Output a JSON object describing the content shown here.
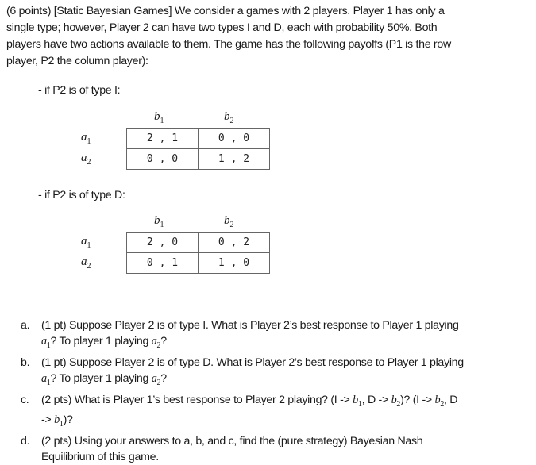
{
  "intro": {
    "lines": [
      "(6 points) [Static Bayesian Games] We consider a games with 2 players. Player 1 has only a",
      "single type; however, Player 2 can have two types I and D, each with probability 50%. Both",
      "players have two actions available to them. The game has the following payoffs (P1 is the row",
      "player, P2 the column player):"
    ]
  },
  "games": [
    {
      "heading": "- if P2 is of type I:",
      "cols": [
        "b",
        "b"
      ],
      "col_subs": [
        "1",
        "2"
      ],
      "rows": [
        "a",
        "a"
      ],
      "row_subs": [
        "1",
        "2"
      ],
      "cells": [
        [
          "2 , 1",
          "0 , 0"
        ],
        [
          "0 , 0",
          "1 , 2"
        ]
      ]
    },
    {
      "heading": "- if P2 is of type D:",
      "cols": [
        "b",
        "b"
      ],
      "col_subs": [
        "1",
        "2"
      ],
      "rows": [
        "a",
        "a"
      ],
      "row_subs": [
        "1",
        "2"
      ],
      "cells": [
        [
          "2 , 0",
          "0 , 2"
        ],
        [
          "0 , 1",
          "1 , 0"
        ]
      ]
    }
  ],
  "questions": [
    {
      "marker": "a.",
      "text1": "(1 pt) Suppose Player 2 is of type I. What is Player 2’s best response to Player 1 playing",
      "text2": "? To player 1 playing ",
      "text3": "?"
    },
    {
      "marker": "b.",
      "text1": "(1 pt) Suppose Player 2 is of type D. What is Player 2’s best response to Player 1 playing",
      "text2": "? To player 1 playing ",
      "text3": "?"
    },
    {
      "marker": "c.",
      "text1": "(2 pts) What is Player 1’s best response to Player 2 playing? (I -> ",
      "text2": ", D -> ",
      "text3": ")? (I -> ",
      "text4": ", D",
      "text5": "-> ",
      "text6": ")?"
    },
    {
      "marker": "d.",
      "text1": "(2 pts) Using your answers to a, b, and c, find the (pure strategy) Bayesian Nash",
      "text2": "Equilibrium of this game."
    }
  ],
  "symbols": {
    "a": "a",
    "b": "b",
    "one": "1",
    "two": "2"
  }
}
